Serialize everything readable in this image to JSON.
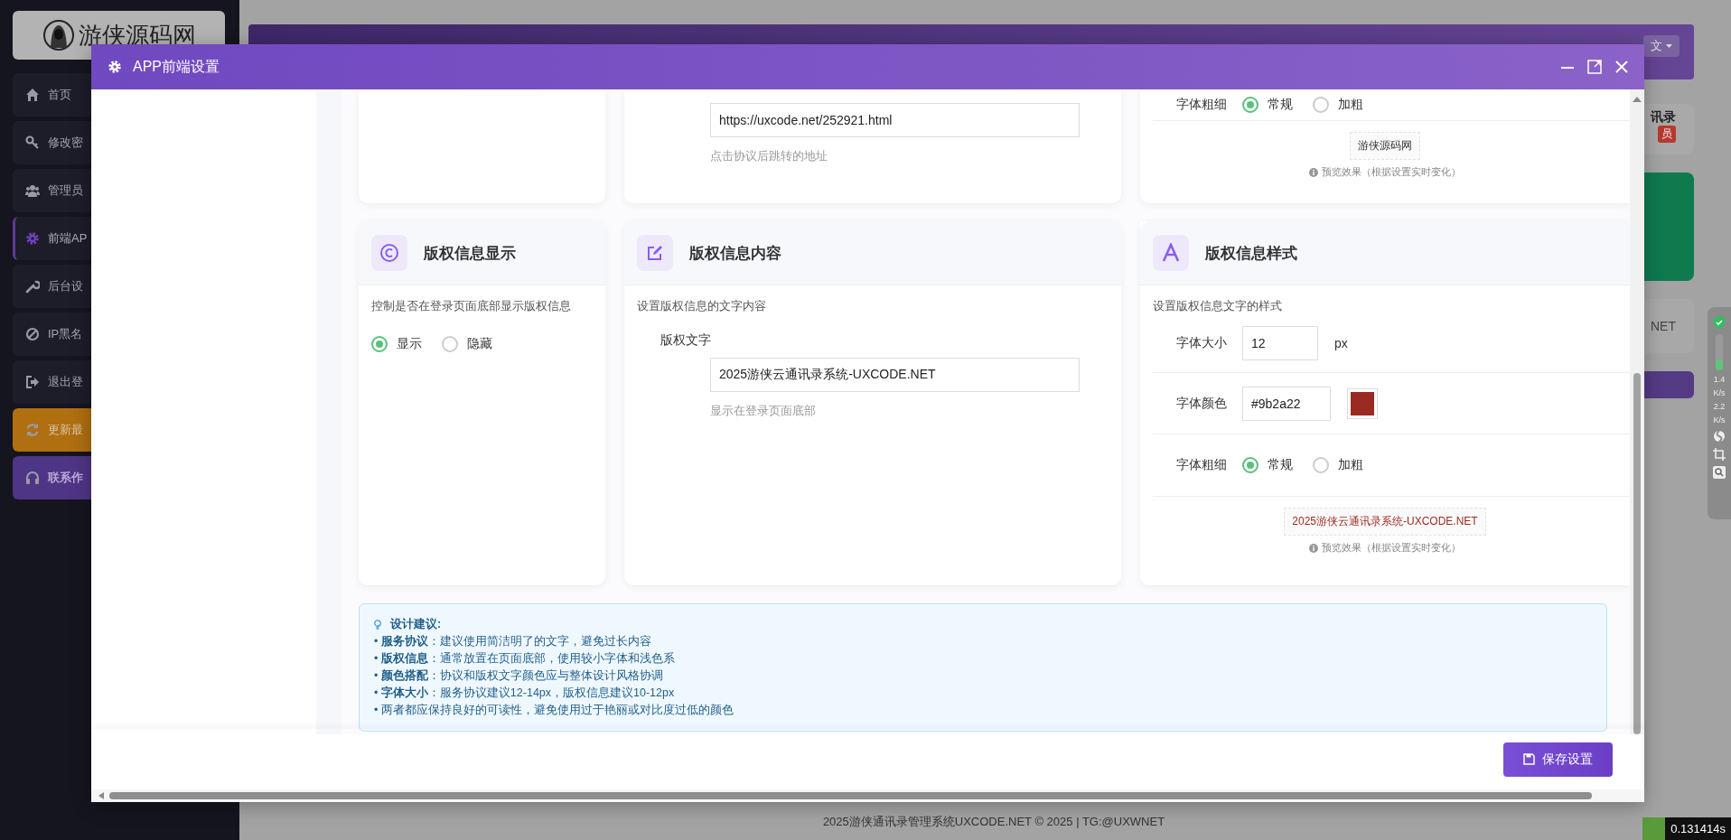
{
  "sidebar": {
    "logo": "游侠源码网",
    "items": [
      {
        "label": "首页",
        "kind": "normal",
        "selected": false
      },
      {
        "label": "修改密",
        "kind": "normal",
        "selected": false
      },
      {
        "label": "管理员",
        "kind": "normal",
        "selected": false
      },
      {
        "label": "前端AP",
        "kind": "normal",
        "selected": true
      },
      {
        "label": "后台设",
        "kind": "normal",
        "selected": false
      },
      {
        "label": "IP黑名",
        "kind": "normal",
        "selected": false
      },
      {
        "label": "退出登",
        "kind": "normal",
        "selected": false
      },
      {
        "label": "更新最",
        "kind": "warning",
        "selected": false
      },
      {
        "label": "联系作",
        "kind": "accent",
        "selected": false
      }
    ]
  },
  "background": {
    "language": "文",
    "card_title": "讯录",
    "badge": "员",
    "panel_text": "NET"
  },
  "modal": {
    "title": "APP前端设置",
    "link_card": {
      "url": "https://uxcode.net/252921.html",
      "hint": "点击协议后跳转的地址"
    },
    "agreement_style_card": {
      "weight_label": "字体粗细",
      "weight_options": [
        {
          "label": "常规",
          "selected": true
        },
        {
          "label": "加粗",
          "selected": false
        }
      ],
      "preview": "游侠源码网",
      "preview_note": "预览效果（根据设置实时变化）"
    },
    "copyright_display_card": {
      "title": "版权信息显示",
      "description": "控制是否在登录页面底部显示版权信息",
      "options": [
        {
          "label": "显示",
          "selected": true
        },
        {
          "label": "隐藏",
          "selected": false
        }
      ]
    },
    "copyright_content_card": {
      "title": "版权信息内容",
      "description": "设置版权信息的文字内容",
      "field_label": "版权文字",
      "value": "2025游侠云通讯录系统-UXCODE.NET",
      "hint": "显示在登录页面底部"
    },
    "copyright_style_card": {
      "title": "版权信息样式",
      "description": "设置版权信息文字的样式",
      "size_label": "字体大小",
      "size": "12",
      "size_unit": "px",
      "color_label": "字体颜色",
      "color_value": "#9b2a22",
      "weight_label": "字体粗细",
      "weight_options": [
        {
          "label": "常规",
          "selected": true
        },
        {
          "label": "加粗",
          "selected": false
        }
      ],
      "preview": "2025游侠云通讯录系统-UXCODE.NET",
      "preview_note": "预览效果（根据设置实时变化）"
    },
    "tips": {
      "title": "设计建议:",
      "items": [
        "• **服务协议**：建议使用简洁明了的文字，避免过长内容",
        "• **版权信息**：通常放置在页面底部，使用较小字体和浅色系",
        "• **颜色搭配**：协议和版权文字颜色应与整体设计风格协调",
        "• **字体大小**：服务协议建议12-14px，版权信息建议10-12px",
        "• 两者都应保持良好的可读性，避免使用过于艳丽或对比度过低的颜色"
      ]
    },
    "save_button": "保存设置"
  },
  "footer": "2025游侠通讯录管理系统UXCODE.NET © 2025 | TG:@UXWNET",
  "timer": "0.131414s",
  "speed_meter": {
    "upload": "1.4",
    "upload_unit": "K/s",
    "download": "2.2",
    "download_unit": "K/s"
  }
}
